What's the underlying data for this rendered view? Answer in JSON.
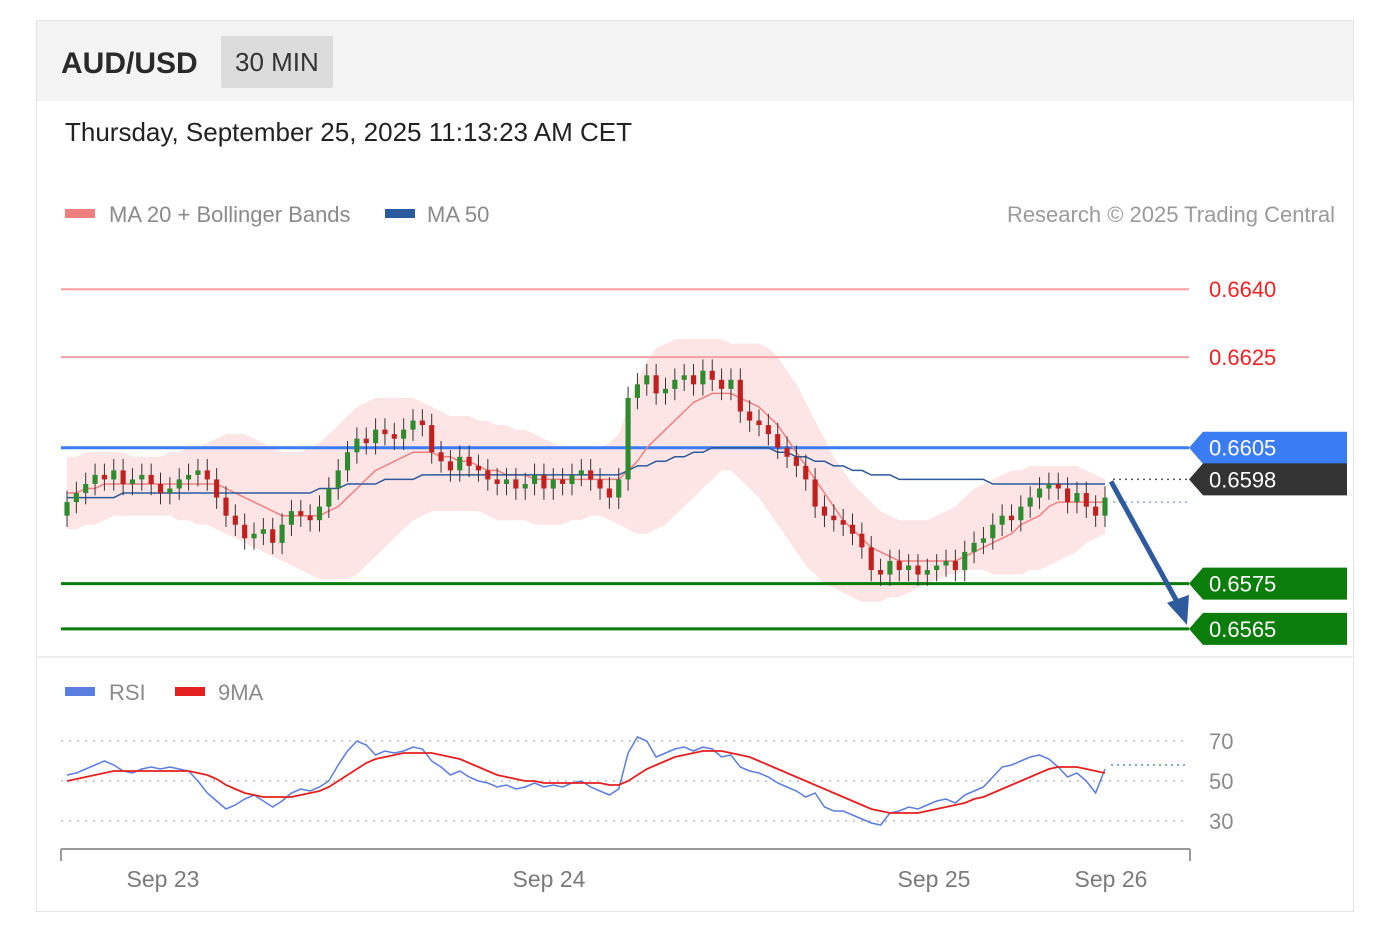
{
  "header": {
    "symbol": "AUD/USD",
    "interval": "30 MIN",
    "datetime": "Thursday, September 25, 2025 11:13:23 AM CET"
  },
  "legend": {
    "bollinger": "MA 20 + Bollinger Bands",
    "ma50": "MA 50",
    "credit": "Research © 2025 Trading Central"
  },
  "rsi_legend": {
    "rsi": "RSI",
    "ma9": "9MA"
  },
  "colors": {
    "resistance": "#f4a0a0",
    "resistance_text": "#ee2222",
    "pivot": "#3a7cf4",
    "support": "#0a7d0a",
    "current": "#333333",
    "ma20": "#f08080",
    "ma50": "#2c5a9e",
    "band_fill": "#fde2e2",
    "candle_up": "#2e8b2e",
    "candle_down": "#c0201e",
    "arrow": "#2e5a9e",
    "rsi": "#5a7de0",
    "rsi_ma": "#e52020"
  },
  "chart_data": [
    {
      "type": "candlestick",
      "title": "",
      "ylim": [
        0.6561,
        0.6648
      ],
      "x_tick_labels": [
        "Sep 23",
        "Sep 24",
        "Sep 25",
        "Sep 26"
      ],
      "levels": [
        {
          "value": 0.664,
          "label": "0.6640",
          "kind": "resistance"
        },
        {
          "value": 0.6625,
          "label": "0.6625",
          "kind": "resistance"
        },
        {
          "value": 0.6605,
          "label": "0.6605",
          "kind": "pivot"
        },
        {
          "value": 0.6598,
          "label": "0.6598",
          "kind": "current"
        },
        {
          "value": 0.6575,
          "label": "0.6575",
          "kind": "support"
        },
        {
          "value": 0.6565,
          "label": "0.6565",
          "kind": "support"
        }
      ],
      "close": [
        0.6593,
        0.6595,
        0.6597,
        0.6599,
        0.6598,
        0.66,
        0.6597,
        0.6598,
        0.6599,
        0.6597,
        0.6595,
        0.6596,
        0.6598,
        0.6599,
        0.66,
        0.6598,
        0.6594,
        0.659,
        0.6588,
        0.6585,
        0.6586,
        0.6587,
        0.6584,
        0.6588,
        0.6591,
        0.659,
        0.6589,
        0.6592,
        0.6596,
        0.66,
        0.6604,
        0.6607,
        0.6606,
        0.6609,
        0.6608,
        0.6607,
        0.6609,
        0.6611,
        0.661,
        0.6604,
        0.6602,
        0.66,
        0.6603,
        0.6601,
        0.66,
        0.6598,
        0.6597,
        0.6598,
        0.6596,
        0.6597,
        0.6599,
        0.6596,
        0.6598,
        0.6597,
        0.6599,
        0.66,
        0.6598,
        0.6596,
        0.6594,
        0.6598,
        0.6616,
        0.6619,
        0.6621,
        0.6617,
        0.6618,
        0.662,
        0.6621,
        0.6619,
        0.6622,
        0.662,
        0.6618,
        0.662,
        0.6613,
        0.6611,
        0.661,
        0.6608,
        0.6605,
        0.6603,
        0.6601,
        0.6598,
        0.6592,
        0.659,
        0.6589,
        0.6588,
        0.6586,
        0.6583,
        0.6578,
        0.6577,
        0.658,
        0.6578,
        0.6579,
        0.6577,
        0.6578,
        0.6579,
        0.658,
        0.6578,
        0.6582,
        0.6584,
        0.6585,
        0.6588,
        0.659,
        0.6589,
        0.6592,
        0.6594,
        0.6596,
        0.6597,
        0.6596,
        0.6593,
        0.6595,
        0.6592,
        0.659,
        0.6594
      ],
      "ma20": [
        0.6595,
        0.6595,
        0.6596,
        0.6596,
        0.6597,
        0.6597,
        0.6597,
        0.6597,
        0.6597,
        0.6597,
        0.6597,
        0.6597,
        0.6597,
        0.6597,
        0.6597,
        0.6597,
        0.6597,
        0.6596,
        0.6595,
        0.6594,
        0.6593,
        0.6592,
        0.6591,
        0.659,
        0.659,
        0.659,
        0.659,
        0.659,
        0.6591,
        0.6592,
        0.6594,
        0.6596,
        0.6598,
        0.66,
        0.6601,
        0.6602,
        0.6603,
        0.6604,
        0.6604,
        0.6604,
        0.6603,
        0.6603,
        0.6602,
        0.6602,
        0.6601,
        0.66,
        0.66,
        0.6599,
        0.6599,
        0.6599,
        0.6598,
        0.6598,
        0.6598,
        0.6598,
        0.6598,
        0.6598,
        0.6598,
        0.6598,
        0.6598,
        0.6598,
        0.66,
        0.6602,
        0.6605,
        0.6607,
        0.6609,
        0.6611,
        0.6613,
        0.6615,
        0.6616,
        0.6617,
        0.6617,
        0.6617,
        0.6616,
        0.6615,
        0.6614,
        0.6612,
        0.661,
        0.6607,
        0.6604,
        0.6601,
        0.6598,
        0.6595,
        0.6592,
        0.6589,
        0.6587,
        0.6585,
        0.6583,
        0.6582,
        0.6581,
        0.658,
        0.658,
        0.658,
        0.658,
        0.658,
        0.658,
        0.658,
        0.6581,
        0.6582,
        0.6583,
        0.6584,
        0.6585,
        0.6586,
        0.6588,
        0.6589,
        0.659,
        0.6592,
        0.6593,
        0.6593,
        0.6593,
        0.6593,
        0.6593,
        0.6593
      ],
      "ma50": [
        0.6594,
        0.6594,
        0.6594,
        0.6594,
        0.6594,
        0.6594,
        0.6595,
        0.6595,
        0.6595,
        0.6595,
        0.6595,
        0.6595,
        0.6595,
        0.6595,
        0.6595,
        0.6595,
        0.6595,
        0.6595,
        0.6595,
        0.6595,
        0.6595,
        0.6595,
        0.6595,
        0.6595,
        0.6595,
        0.6595,
        0.6595,
        0.6596,
        0.6596,
        0.6596,
        0.6597,
        0.6597,
        0.6597,
        0.6597,
        0.6598,
        0.6598,
        0.6598,
        0.6598,
        0.6599,
        0.6599,
        0.6599,
        0.6599,
        0.6599,
        0.6599,
        0.6599,
        0.6599,
        0.6599,
        0.6599,
        0.6599,
        0.6599,
        0.6599,
        0.6599,
        0.6599,
        0.6599,
        0.6599,
        0.6599,
        0.6599,
        0.6599,
        0.6599,
        0.6599,
        0.66,
        0.6601,
        0.6601,
        0.6602,
        0.6602,
        0.6603,
        0.6603,
        0.6604,
        0.6604,
        0.6605,
        0.6605,
        0.6605,
        0.6605,
        0.6605,
        0.6605,
        0.6605,
        0.6604,
        0.6604,
        0.6603,
        0.6603,
        0.6602,
        0.6602,
        0.6601,
        0.6601,
        0.66,
        0.66,
        0.6599,
        0.6599,
        0.6599,
        0.6598,
        0.6598,
        0.6598,
        0.6598,
        0.6598,
        0.6598,
        0.6598,
        0.6598,
        0.6598,
        0.6598,
        0.6597,
        0.6597,
        0.6597,
        0.6597,
        0.6597,
        0.6597,
        0.6597,
        0.6597,
        0.6597,
        0.6597,
        0.6597,
        0.6597,
        0.6597
      ],
      "band_upper": [
        0.6603,
        0.6603,
        0.6604,
        0.6604,
        0.6604,
        0.6604,
        0.6604,
        0.6603,
        0.6603,
        0.6603,
        0.6603,
        0.6604,
        0.6604,
        0.6605,
        0.6605,
        0.6606,
        0.6607,
        0.6608,
        0.6608,
        0.6608,
        0.6607,
        0.6606,
        0.6605,
        0.6604,
        0.6604,
        0.6604,
        0.6605,
        0.6606,
        0.6608,
        0.661,
        0.6612,
        0.6614,
        0.6615,
        0.6616,
        0.6616,
        0.6616,
        0.6616,
        0.6616,
        0.6615,
        0.6614,
        0.6613,
        0.6612,
        0.6612,
        0.6612,
        0.6611,
        0.6611,
        0.661,
        0.661,
        0.6609,
        0.6609,
        0.6608,
        0.6607,
        0.6606,
        0.6605,
        0.6605,
        0.6605,
        0.6605,
        0.6605,
        0.6606,
        0.6608,
        0.6614,
        0.662,
        0.6624,
        0.6627,
        0.6628,
        0.6629,
        0.6629,
        0.6629,
        0.6629,
        0.6629,
        0.6629,
        0.6628,
        0.6628,
        0.6628,
        0.6628,
        0.6627,
        0.6625,
        0.6622,
        0.6619,
        0.6615,
        0.6611,
        0.6607,
        0.6603,
        0.66,
        0.6597,
        0.6595,
        0.6593,
        0.6591,
        0.659,
        0.6589,
        0.6589,
        0.6589,
        0.6589,
        0.659,
        0.6591,
        0.6592,
        0.6594,
        0.6596,
        0.6597,
        0.6598,
        0.6599,
        0.66,
        0.66,
        0.6601,
        0.6601,
        0.6601,
        0.6601,
        0.6601,
        0.6601,
        0.66,
        0.6599,
        0.6598
      ],
      "band_lower": [
        0.6587,
        0.6587,
        0.6588,
        0.6588,
        0.6589,
        0.659,
        0.659,
        0.659,
        0.659,
        0.659,
        0.659,
        0.659,
        0.6589,
        0.6589,
        0.6588,
        0.6588,
        0.6587,
        0.6586,
        0.6585,
        0.6584,
        0.6583,
        0.6582,
        0.6581,
        0.658,
        0.6579,
        0.6578,
        0.6577,
        0.6576,
        0.6576,
        0.6576,
        0.6576,
        0.6577,
        0.6579,
        0.6581,
        0.6583,
        0.6585,
        0.6587,
        0.6589,
        0.659,
        0.6591,
        0.6591,
        0.6591,
        0.6591,
        0.6591,
        0.6591,
        0.659,
        0.6589,
        0.6589,
        0.6589,
        0.6589,
        0.6588,
        0.6588,
        0.6588,
        0.6588,
        0.6589,
        0.6589,
        0.659,
        0.659,
        0.6589,
        0.6588,
        0.6587,
        0.6586,
        0.6586,
        0.6587,
        0.6588,
        0.659,
        0.6592,
        0.6594,
        0.6596,
        0.6598,
        0.66,
        0.66,
        0.6598,
        0.6596,
        0.6594,
        0.6591,
        0.6588,
        0.6585,
        0.6582,
        0.6579,
        0.6577,
        0.6575,
        0.6574,
        0.6573,
        0.6572,
        0.6571,
        0.6571,
        0.6571,
        0.6572,
        0.6572,
        0.6573,
        0.6574,
        0.6575,
        0.6576,
        0.6577,
        0.6577,
        0.6578,
        0.6578,
        0.6578,
        0.6577,
        0.6577,
        0.6577,
        0.6577,
        0.6578,
        0.6578,
        0.6579,
        0.658,
        0.6581,
        0.6582,
        0.6584,
        0.6585,
        0.6586
      ]
    },
    {
      "type": "line",
      "title": "",
      "ylim": [
        20,
        80
      ],
      "y_ticks": [
        70,
        50,
        30
      ],
      "series": [
        {
          "name": "RSI",
          "values": [
            53,
            54,
            56,
            58,
            60,
            58,
            55,
            54,
            56,
            57,
            56,
            57,
            56,
            55,
            50,
            44,
            40,
            36,
            38,
            41,
            43,
            40,
            37,
            40,
            44,
            46,
            45,
            47,
            50,
            58,
            65,
            70,
            68,
            63,
            65,
            64,
            65,
            67,
            66,
            60,
            57,
            53,
            55,
            52,
            50,
            49,
            47,
            48,
            46,
            47,
            49,
            47,
            48,
            47,
            49,
            50,
            47,
            45,
            43,
            46,
            64,
            72,
            70,
            62,
            64,
            66,
            67,
            65,
            67,
            66,
            62,
            63,
            57,
            55,
            54,
            52,
            49,
            47,
            45,
            42,
            44,
            37,
            35,
            35,
            33,
            31,
            29,
            28,
            34,
            35,
            37,
            36,
            38,
            40,
            41,
            39,
            43,
            45,
            47,
            52,
            57,
            58,
            60,
            62,
            63,
            61,
            57,
            52,
            54,
            50,
            44,
            56
          ]
        },
        {
          "name": "9MA",
          "values": [
            50,
            51,
            52,
            53,
            54,
            55,
            55,
            55,
            55,
            55,
            55,
            55,
            55,
            55,
            54,
            53,
            51,
            48,
            46,
            44,
            43,
            42,
            42,
            42,
            42,
            43,
            44,
            45,
            47,
            50,
            53,
            56,
            59,
            61,
            62,
            63,
            64,
            64,
            64,
            64,
            63,
            62,
            61,
            59,
            57,
            55,
            53,
            52,
            51,
            50,
            50,
            49,
            49,
            49,
            49,
            49,
            49,
            49,
            48,
            48,
            50,
            53,
            56,
            58,
            60,
            62,
            63,
            64,
            65,
            65,
            65,
            64,
            63,
            62,
            60,
            58,
            56,
            54,
            52,
            50,
            48,
            46,
            44,
            42,
            40,
            38,
            36,
            35,
            34,
            34,
            34,
            34,
            35,
            36,
            37,
            38,
            39,
            41,
            42,
            44,
            46,
            48,
            50,
            52,
            54,
            56,
            57,
            57,
            57,
            56,
            55,
            54
          ]
        }
      ],
      "projection": 58
    }
  ]
}
